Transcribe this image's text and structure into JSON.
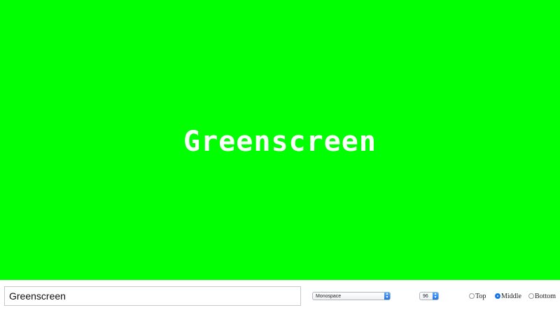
{
  "stage": {
    "text": "Greenscreen",
    "background": "#00ff00",
    "text_color": "#ffffff"
  },
  "controls": {
    "text_input_value": "Greenscreen",
    "font_select_value": "Monospace",
    "size_select_value": "96",
    "position_options": [
      {
        "label": "Top",
        "checked": false
      },
      {
        "label": "Middle",
        "checked": true
      },
      {
        "label": "Bottom",
        "checked": false
      }
    ]
  }
}
